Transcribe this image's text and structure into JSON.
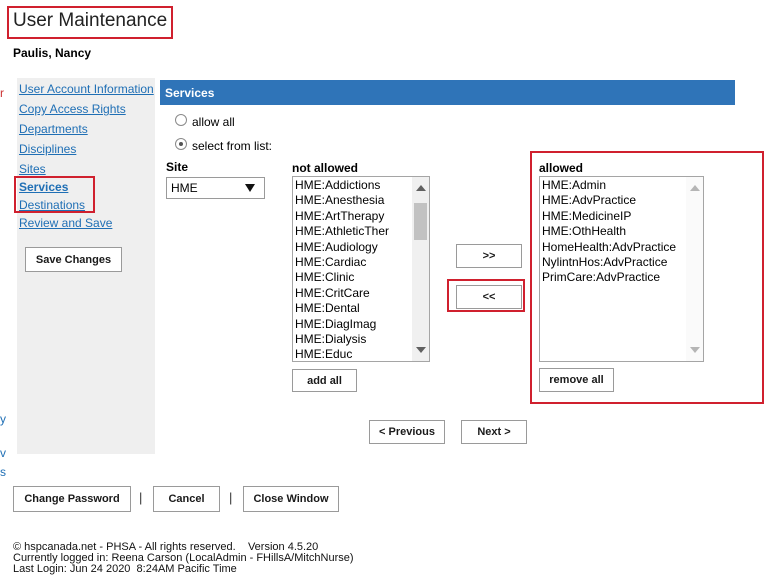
{
  "page": {
    "title": "User Maintenance",
    "user_name": "Paulis, Nancy"
  },
  "colors": {
    "accent": "#2f74b8",
    "highlight": "#d0202e",
    "link": "#1f6fb5",
    "sidebar_bg": "#efefef"
  },
  "sidebar": {
    "items": [
      {
        "label": "User Account Information"
      },
      {
        "label": "Copy Access Rights"
      },
      {
        "label": "Departments"
      },
      {
        "label": "Disciplines"
      },
      {
        "label": "Sites"
      },
      {
        "label": "Services"
      },
      {
        "label": "Destinations"
      },
      {
        "label": "Review and Save"
      }
    ],
    "save_button": "Save Changes"
  },
  "services": {
    "header": "Services",
    "radio_allow_all": "allow all",
    "radio_select_from_list": "select from list:",
    "site_label": "Site",
    "site_value": "HME",
    "not_allowed_label": "not allowed",
    "not_allowed": [
      "HME:Addictions",
      "HME:Anesthesia",
      "HME:ArtTherapy",
      "HME:AthleticTher",
      "HME:Audiology",
      "HME:Cardiac",
      "HME:Clinic",
      "HME:CritCare",
      "HME:Dental",
      "HME:DiagImag",
      "HME:Dialysis",
      "HME:Educ"
    ],
    "allowed_label": "allowed",
    "allowed": [
      "HME:Admin",
      "HME:AdvPractice",
      "HME:MedicineIP",
      "HME:OthHealth",
      "HomeHealth:AdvPractice",
      "NylintnHos:AdvPractice",
      "PrimCare:AdvPractice"
    ],
    "add_button": ">>",
    "remove_button": "<<",
    "add_all_button": "add all",
    "remove_all_button": "remove all",
    "previous_button": "< Previous",
    "next_button": "Next >"
  },
  "actions": {
    "change_password": "Change Password",
    "cancel": "Cancel",
    "close_window": "Close Window",
    "separator": "|"
  },
  "footer": {
    "copyright": "© hspcanada.net - PHSA - All rights reserved.",
    "version": "Version 4.5.20",
    "logged_in": "Currently logged in: Reena Carson (LocalAdmin - FHillsA/MitchNurse)",
    "last_login": "Last Login: Jun 24 2020  8:24AM Pacific Time"
  },
  "left_edge_glyphs": [
    "r",
    "y",
    "v",
    "s"
  ]
}
